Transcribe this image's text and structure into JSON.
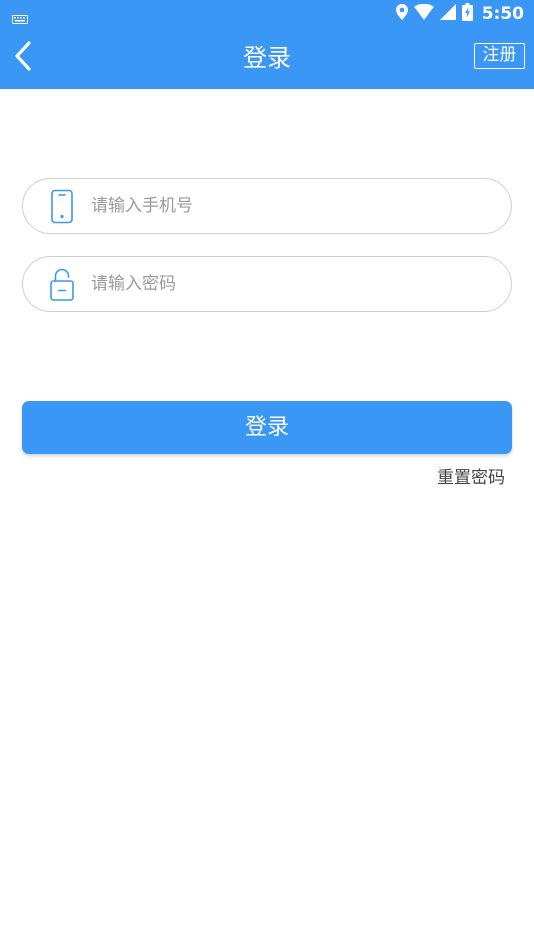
{
  "status_bar": {
    "time": "5:50",
    "icons": [
      "keyboard-icon",
      "location-icon",
      "wifi-icon",
      "signal-icon",
      "battery-icon"
    ]
  },
  "app_bar": {
    "title": "登录",
    "back_icon": "chevron-left-icon",
    "register_label": "注册"
  },
  "form": {
    "phone": {
      "icon": "phone-icon",
      "placeholder": "请输入手机号",
      "value": ""
    },
    "password": {
      "icon": "lock-icon",
      "placeholder": "请输入密码",
      "value": ""
    },
    "login_label": "登录",
    "reset_label": "重置密码"
  },
  "colors": {
    "primary": "#3a97f6",
    "border": "#cfcfcf",
    "placeholder": "#9a9a9a",
    "link": "#444444"
  }
}
